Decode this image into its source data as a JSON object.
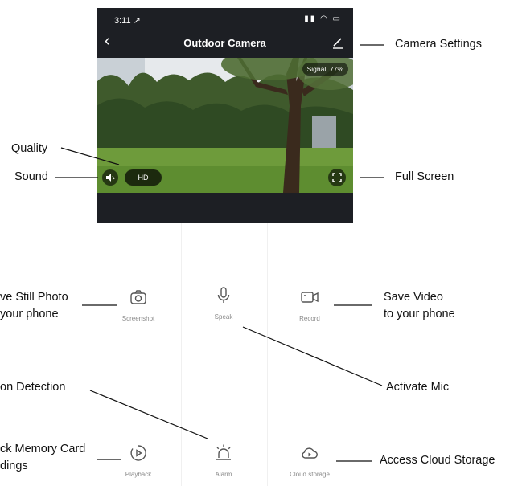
{
  "status_bar": {
    "time": "3:11 ↗",
    "icons": "▮▮ ◠ ▭"
  },
  "header": {
    "back": "‹",
    "title": "Outdoor Camera"
  },
  "video": {
    "signal": "Signal: 77%",
    "quality_label": "HD"
  },
  "controls": [
    {
      "label": "Screenshot",
      "icon": "camera-icon"
    },
    {
      "label": "Speak",
      "icon": "microphone-icon"
    },
    {
      "label": "Record",
      "icon": "video-camera-icon"
    },
    {
      "label": "Playback",
      "icon": "playback-icon"
    },
    {
      "label": "Alarm",
      "icon": "alarm-icon"
    },
    {
      "label": "Cloud storage",
      "icon": "cloud-icon"
    }
  ],
  "annotations": {
    "camera_settings": "Camera Settings",
    "quality": "Quality",
    "sound": "Sound",
    "full_screen": "Full Screen",
    "save_still_photo_1": "ve Still Photo",
    "save_still_photo_2": "your phone",
    "save_video_1": "Save Video",
    "save_video_2": "to your phone",
    "activate_mic": "Activate Mic",
    "motion_detection": "on Detection",
    "playback_1": "ck Memory Card",
    "playback_2": "dings",
    "cloud_storage": "Access Cloud Storage"
  },
  "colors": {
    "header_bg": "#1d1f24",
    "icon_gray": "#555555",
    "label_gray": "#888888"
  }
}
